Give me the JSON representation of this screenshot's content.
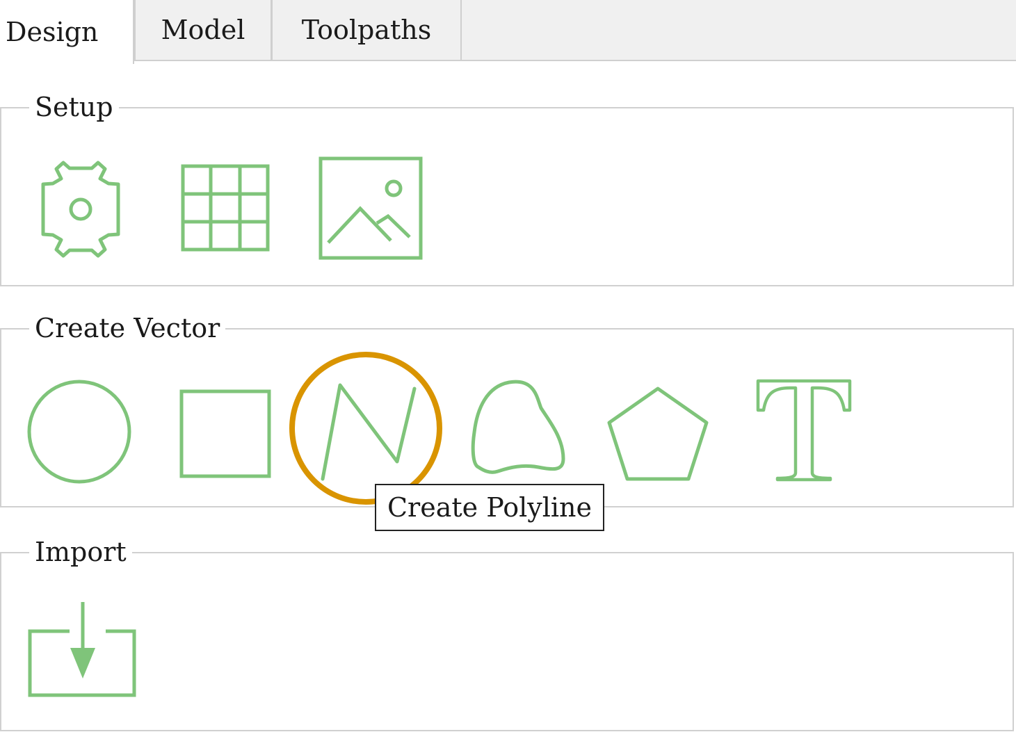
{
  "tabs": {
    "design": "Design",
    "model": "Model",
    "toolpaths": "Toolpaths",
    "active": "Design"
  },
  "groups": {
    "setup": {
      "title": "Setup",
      "tools": [
        "settings-icon",
        "grid-icon",
        "image-icon"
      ]
    },
    "create_vector": {
      "title": "Create Vector",
      "tools": [
        "circle-icon",
        "rectangle-icon",
        "polyline-icon",
        "freehand-icon",
        "polygon-icon",
        "text-icon"
      ],
      "highlighted_tool": "polyline-icon"
    },
    "import": {
      "title": "Import",
      "tools": [
        "import-icon"
      ]
    }
  },
  "tooltip": {
    "text": "Create Polyline"
  },
  "colors": {
    "icon": "#7fc47a",
    "highlight": "#d99400",
    "tab_bar": "#f0f0f0",
    "border": "#d0d0d0"
  }
}
